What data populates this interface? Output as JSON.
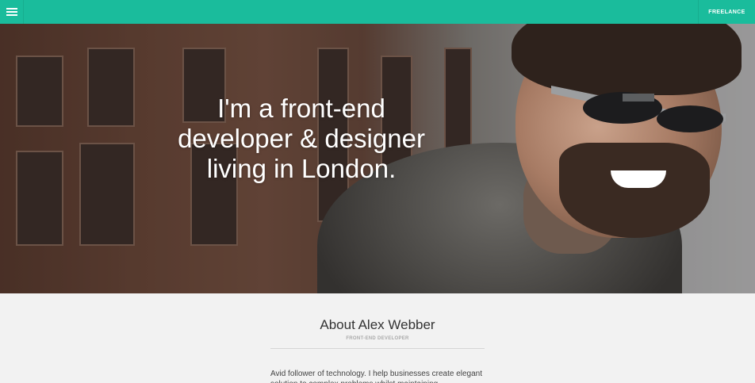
{
  "topbar": {
    "menu_icon": "hamburger-menu-icon",
    "freelance_label": "FREELANCE",
    "accent_color": "#1abc9c"
  },
  "hero": {
    "title_lines": [
      "I'm a front-end",
      "developer & designer",
      "living in London."
    ]
  },
  "about": {
    "title": "About Alex Webber",
    "subtitle": "FRONT-END DEVELOPER",
    "text": "Avid follower of technology. I help businesses create elegant solution to complex problems whilst maintaining"
  }
}
